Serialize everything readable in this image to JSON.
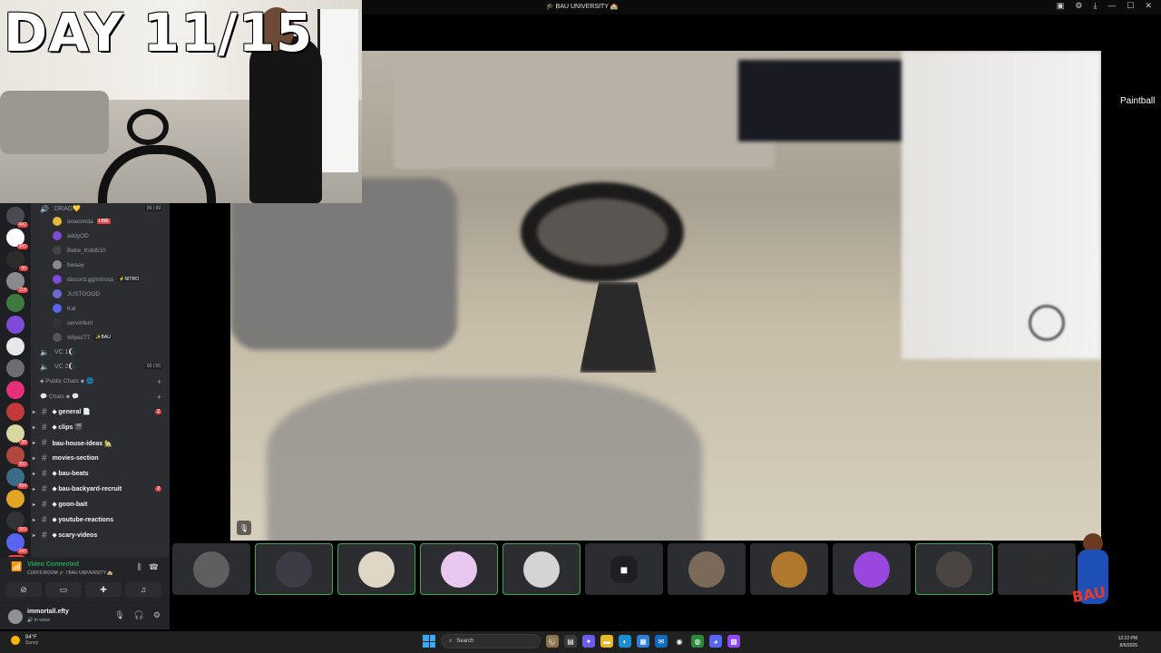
{
  "window": {
    "title": "🎓 BAU UNIVERSITY 🏫",
    "icons": [
      "▣",
      "⚙",
      "⤓",
      "—",
      "☐",
      "✕"
    ]
  },
  "overlay": {
    "day_text": "DAY 11/15"
  },
  "servers": [
    {
      "count": "442",
      "color": "#4a4a52"
    },
    {
      "count": "343",
      "color": "#ffffff"
    },
    {
      "count": "90",
      "color": "#2b2b2b"
    },
    {
      "count": "218",
      "color": "#8a8a8a"
    },
    {
      "count": "",
      "color": "#3e7a3e"
    },
    {
      "count": "",
      "color": "#7d4bd8"
    },
    {
      "count": "",
      "color": "#e8e8e8"
    },
    {
      "count": "",
      "color": "#6e6e6e"
    },
    {
      "count": "",
      "color": "#e72f7b"
    },
    {
      "count": "",
      "color": "#c23a3a"
    },
    {
      "count": "38",
      "color": "#d7d7a0"
    },
    {
      "count": "302",
      "color": "#b0463d"
    },
    {
      "count": "394",
      "color": "#3d6b8a"
    },
    {
      "count": "",
      "color": "#e2a526"
    },
    {
      "count": "109",
      "color": "#333333"
    },
    {
      "count": "143",
      "color": "#5865f2"
    }
  ],
  "new_badge": "NEW",
  "channel_list": {
    "drag_channel": {
      "label": "DRAG💛",
      "counts": "09 | 99"
    },
    "members": [
      {
        "name": "anaconda",
        "live": "LIVE",
        "color": "#e2b93b"
      },
      {
        "name": "addyOD",
        "color": "#7d4bd8"
      },
      {
        "name": "Bebe_Kidd510",
        "color": "#444444"
      },
      {
        "name": "bwaay",
        "color": "#8a8a8a"
      },
      {
        "name": "discord.gg/nitrous",
        "tag": "⚡NITRO",
        "color": "#7d4bd8"
      },
      {
        "name": "JUSTGOOD",
        "color": "#6b6bd0"
      },
      {
        "name": "Kal",
        "color": "#5865f2"
      },
      {
        "name": "servinfent",
        "color": "#333333"
      },
      {
        "name": "Wipez77",
        "tag": "✨BAU",
        "color": "#555555"
      }
    ],
    "vc1": "VC 1🌘",
    "vc2": "VC 2🌘",
    "vc2_counts": "00 | 50",
    "public_chats": "⬥ Public Chats ⬥ 🌐",
    "chats_cat": "💬 Chats ⬥ 💬",
    "channels": [
      {
        "name": "⬥ general 📄",
        "bold": true,
        "pill": "2"
      },
      {
        "name": "⬥ clips 🎬",
        "bold": true,
        "pill": ""
      },
      {
        "name": "bau-house-ideas 🏡",
        "bold": true,
        "pill": ""
      },
      {
        "name": "movies-section",
        "bold": true,
        "pill": ""
      },
      {
        "name": "⬥ bau-beats",
        "bold": true,
        "pill": ""
      },
      {
        "name": "⬥ bau-backyard-recruit",
        "bold": true,
        "pill": "2"
      },
      {
        "name": "⬥ goon-bait",
        "bold": true,
        "pill": ""
      },
      {
        "name": "⬥ youtube-reactions",
        "bold": true,
        "pill": ""
      },
      {
        "name": "⬥ scary-videos",
        "bold": true,
        "pill": ""
      }
    ]
  },
  "voice_panel": {
    "status": "Video Connected",
    "sub": "CUFFS ROOM 🎓 / BAU UNIVERSITY 🏫"
  },
  "user_panel": {
    "name": "immortall.efty",
    "status": "🔊 In voice"
  },
  "stream": {
    "side_label": "Paintball"
  },
  "participants": [
    {
      "kind": "avatar",
      "color": "#5f5f5f",
      "speaking": false
    },
    {
      "kind": "avatar",
      "color": "#3c3c46",
      "speaking": true
    },
    {
      "kind": "avatar",
      "color": "#e0d6c6",
      "speaking": true
    },
    {
      "kind": "avatar",
      "color": "#e9c8f0",
      "speaking": true
    },
    {
      "kind": "avatar",
      "color": "#d4d4d4",
      "speaking": true
    },
    {
      "kind": "camera-off",
      "color": "#1e1f22",
      "speaking": false
    },
    {
      "kind": "avatar",
      "color": "#7b6a5a",
      "speaking": false
    },
    {
      "kind": "avatar",
      "color": "#b0782c",
      "speaking": false
    },
    {
      "kind": "avatar",
      "color": "#9a47e0",
      "speaking": false
    },
    {
      "kind": "avatar",
      "color": "#4a4543",
      "speaking": true
    },
    {
      "kind": "avatar",
      "color": "#2d2d2d",
      "speaking": false
    }
  ],
  "taskbar": {
    "weather_temp": "84°F",
    "weather_desc": "Sunny",
    "search_placeholder": "Search",
    "time": "12:22 PM",
    "date": "8/6/2026",
    "apps": [
      {
        "name": "sloth-app-icon",
        "color": "#8a7450",
        "glyph": "🦥"
      },
      {
        "name": "explorer-icon",
        "color": "#3a3a3a",
        "glyph": "▤"
      },
      {
        "name": "copilot-icon",
        "color": "#6b5ce8",
        "glyph": "✦"
      },
      {
        "name": "folder-icon",
        "color": "#e8b92b",
        "glyph": "▬"
      },
      {
        "name": "edge-icon",
        "color": "#1b8fd2",
        "glyph": "◐"
      },
      {
        "name": "store-icon",
        "color": "#2f7fd6",
        "glyph": "▦"
      },
      {
        "name": "outlook-icon",
        "color": "#0f6cbd",
        "glyph": "✉"
      },
      {
        "name": "obs-icon",
        "color": "#222222",
        "glyph": "◉"
      },
      {
        "name": "chrome-icon",
        "color": "#2a8a3a",
        "glyph": "◍"
      },
      {
        "name": "discord-icon",
        "color": "#5865f2",
        "glyph": "◕"
      },
      {
        "name": "twitch-icon",
        "color": "#9146ff",
        "glyph": "▩"
      }
    ]
  }
}
